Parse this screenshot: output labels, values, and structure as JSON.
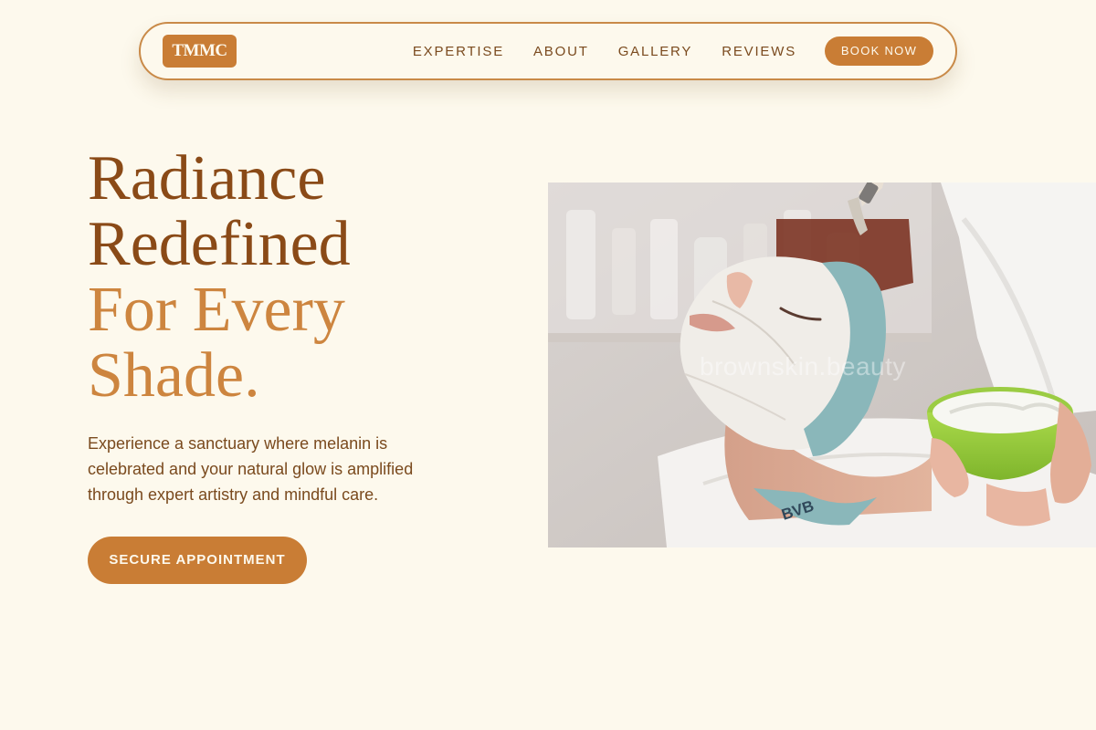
{
  "nav": {
    "logo": "TMMC",
    "links": [
      "EXPERTISE",
      "ABOUT",
      "GALLERY",
      "REVIEWS"
    ],
    "cta": "BOOK NOW"
  },
  "hero": {
    "title_line1": "Radiance",
    "title_line2": "Redefined",
    "title_line3": "For Every",
    "title_line4": "Shade.",
    "description": "Experience a sanctuary where melanin is celebrated and your natural glow is amplified through expert artistry and mindful care.",
    "cta": "SECURE APPOINTMENT"
  },
  "photo": {
    "watermark": "brownskin.beauty",
    "headband_text": "BVB"
  },
  "colors": {
    "background": "#fdf9ed",
    "accent": "#c97d35",
    "heading_dark": "#8a4a17",
    "heading_light": "#cd853f",
    "body_text": "#7a4a1e"
  }
}
